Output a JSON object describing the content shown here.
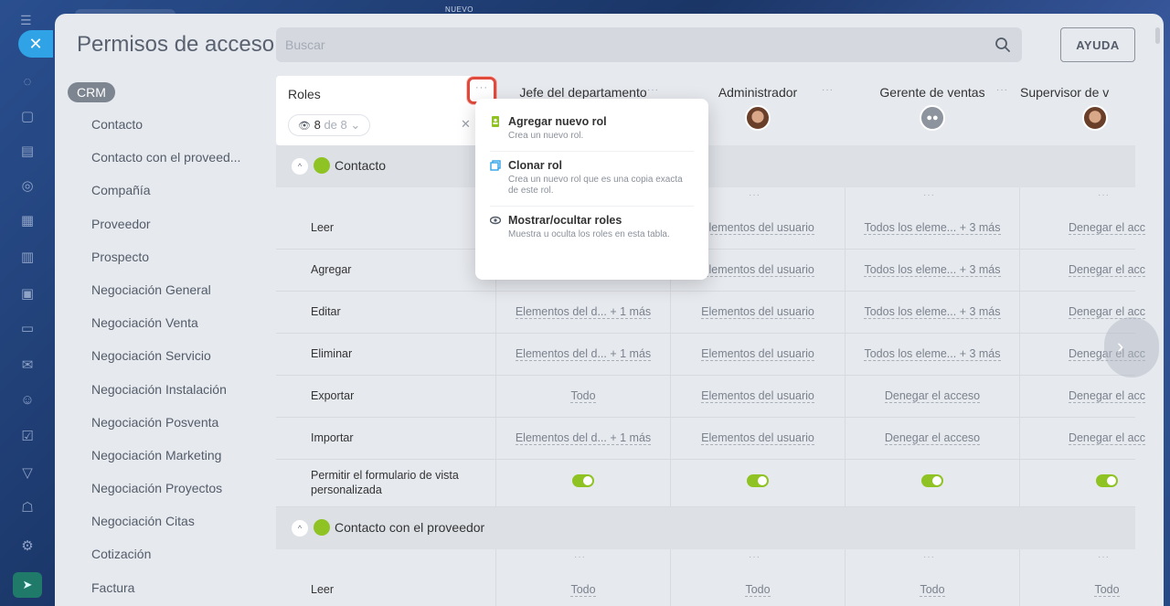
{
  "background": {
    "top_label": "NUEVO"
  },
  "header": {
    "title": "Permisos de acceso",
    "search_placeholder": "Buscar",
    "help_label": "AYUDA"
  },
  "sidebar": {
    "tag": "CRM",
    "items": [
      "Contacto",
      "Contacto con el proveed...",
      "Compañía",
      "Proveedor",
      "Prospecto",
      "Negociación General",
      "Negociación Venta",
      "Negociación Servicio",
      "Negociación Instalación",
      "Negociación Posventa",
      "Negociación Marketing",
      "Negociación Proyectos",
      "Negociación Citas",
      "Cotización",
      "Factura"
    ]
  },
  "roles_header": {
    "title": "Roles",
    "dots": "···",
    "count_current": "8",
    "count_of": "de 8",
    "close": "✕"
  },
  "roles": [
    {
      "name": "Jefe del departamento"
    },
    {
      "name": "Administrador"
    },
    {
      "name": "Gerente de ventas"
    },
    {
      "name": "Supervisor de v"
    }
  ],
  "menu": {
    "items": [
      {
        "title": "Agregar nuevo rol",
        "desc": "Crea un nuevo rol."
      },
      {
        "title": "Clonar rol",
        "desc": "Crea un nuevo rol que es una copia exacta de este rol."
      },
      {
        "title": "Mostrar/ocultar roles",
        "desc": "Muestra u oculta los roles en esta tabla."
      }
    ]
  },
  "sections": [
    {
      "label": "Contacto",
      "rows": [
        {
          "label": "Leer",
          "values": [
            "",
            "Elementos del usuario",
            "Todos los eleme... + 3 más",
            "Denegar el acc"
          ]
        },
        {
          "label": "Agregar",
          "values": [
            "",
            "Elementos del usuario",
            "Todos los eleme... + 3 más",
            "Denegar el acc"
          ]
        },
        {
          "label": "Editar",
          "values": [
            "Elementos del d... + 1 más",
            "Elementos del usuario",
            "Todos los eleme... + 3 más",
            "Denegar el acc"
          ]
        },
        {
          "label": "Eliminar",
          "values": [
            "Elementos del d... + 1 más",
            "Elementos del usuario",
            "Todos los eleme... + 3 más",
            "Denegar el acc"
          ]
        },
        {
          "label": "Exportar",
          "values": [
            "Todo",
            "Elementos del usuario",
            "Denegar el acceso",
            "Denegar el acc"
          ]
        },
        {
          "label": "Importar",
          "values": [
            "Elementos del d... + 1 más",
            "Elementos del usuario",
            "Denegar el acceso",
            "Denegar el acc"
          ]
        },
        {
          "label": "Permitir el formulario de vista personalizada",
          "toggle": true
        }
      ]
    },
    {
      "label": "Contacto con el proveedor",
      "rows": [
        {
          "label": "Leer",
          "values": [
            "Todo",
            "Todo",
            "Todo",
            "Todo"
          ]
        }
      ]
    }
  ],
  "colors": {
    "accent": "#2fa3e6",
    "toggle_on": "#8fc324",
    "highlight": "#e04a3c"
  }
}
